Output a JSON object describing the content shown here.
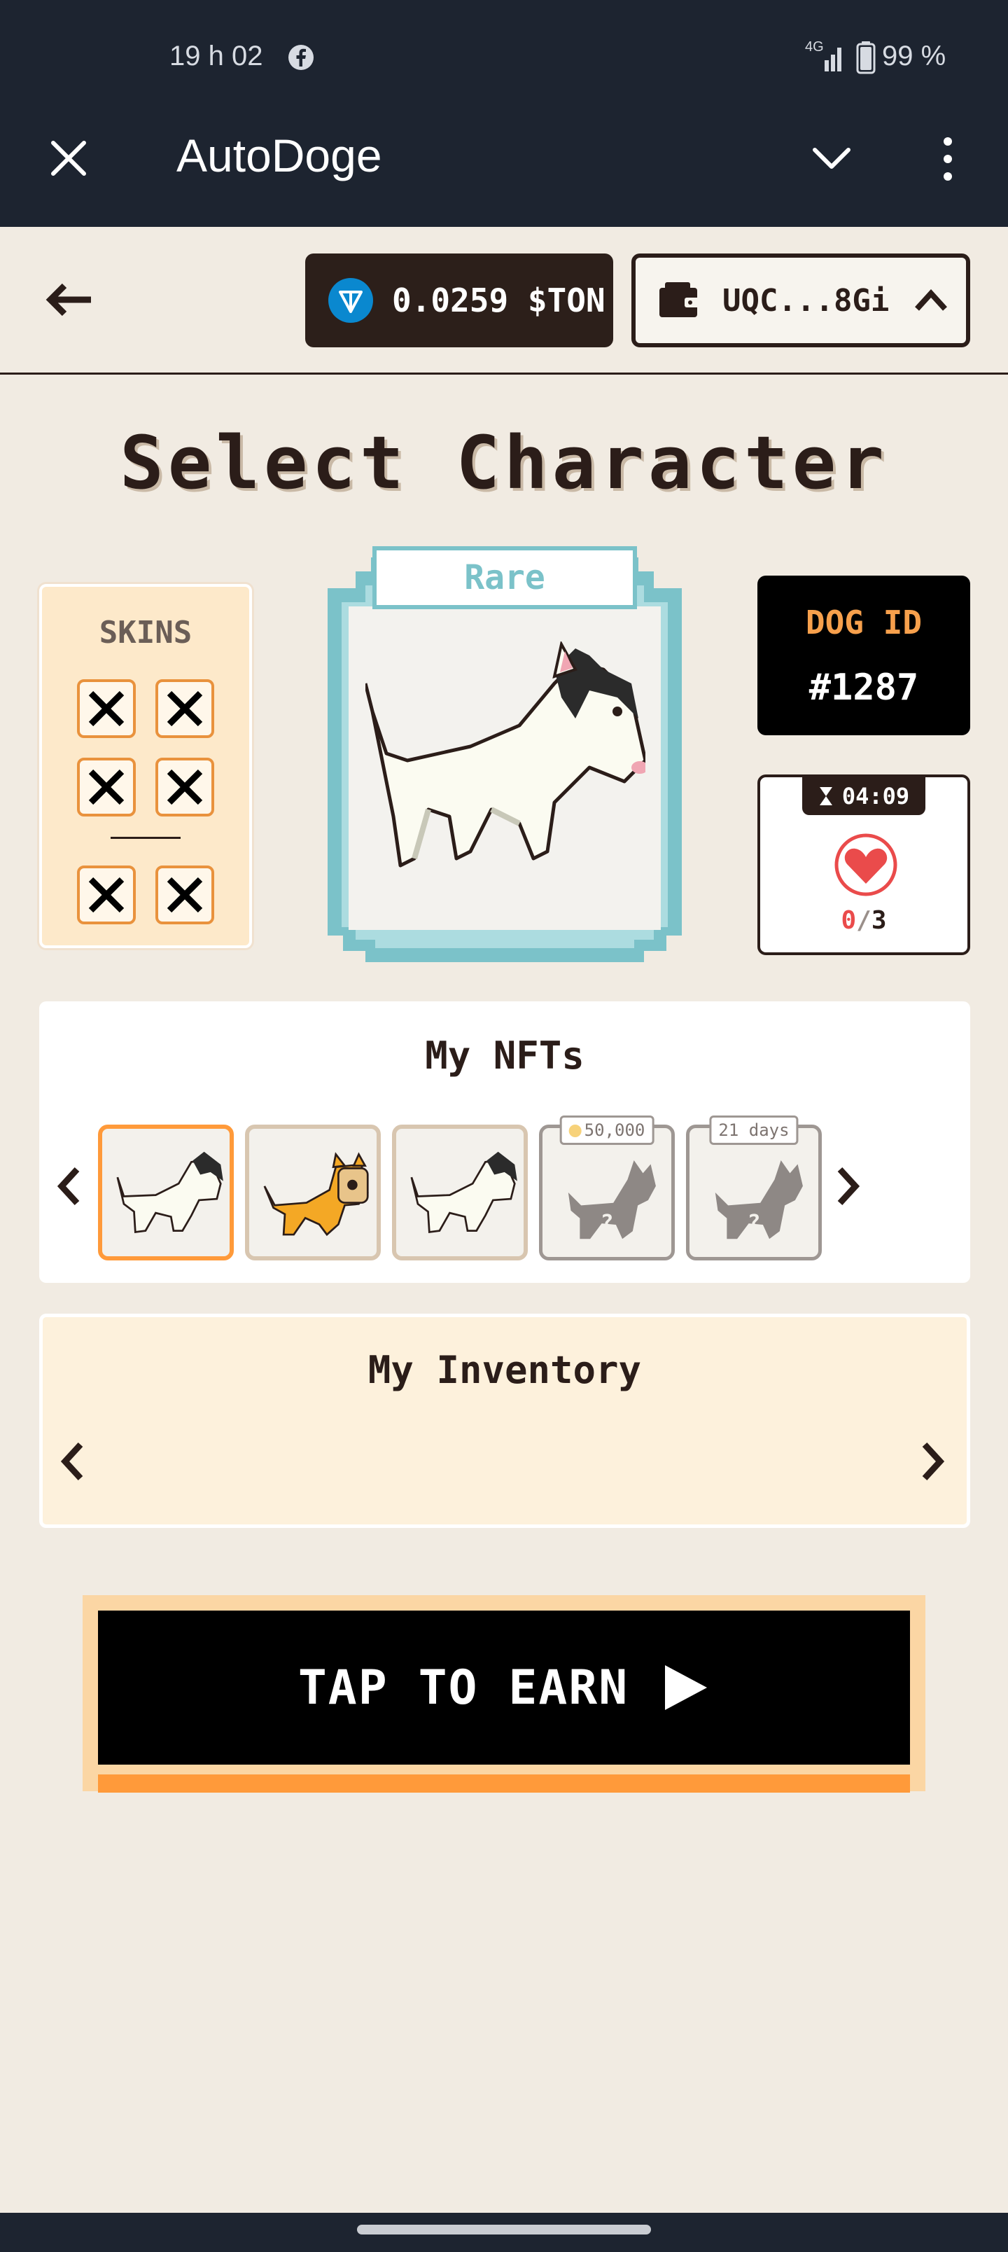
{
  "status_bar": {
    "time": "19 h 02",
    "network": "4G",
    "battery": "99 %"
  },
  "app_bar": {
    "title": "AutoDoge"
  },
  "header": {
    "ton_balance": "0.0259 $TON",
    "wallet_address": "UQC...8Gi"
  },
  "page": {
    "title": "Select Character"
  },
  "skins": {
    "label": "SKINS",
    "slot_count": 6
  },
  "character": {
    "rarity": "Rare"
  },
  "dog": {
    "id_label": "DOG ID",
    "id_value": "#1287"
  },
  "energy": {
    "timer": "04:09",
    "current": "0",
    "separator": "/",
    "max": "3"
  },
  "nfts": {
    "title": "My NFTs",
    "items": [
      {
        "kind": "bull-terrier",
        "selected": true
      },
      {
        "kind": "shiba-toast",
        "selected": false
      },
      {
        "kind": "bull-terrier",
        "selected": false
      },
      {
        "kind": "locked",
        "badge": "50,000"
      },
      {
        "kind": "locked",
        "badge": "21 days"
      }
    ]
  },
  "inventory": {
    "title": "My Inventory"
  },
  "cta": {
    "label": "TAP TO EARN"
  },
  "colors": {
    "app_bar": "#1d2430",
    "background": "#f1ebe2",
    "accent_orange": "#e9923d",
    "rare_teal": "#7bc2c9",
    "dog_id_text": "#f7a04c",
    "heart_red": "#ea4b4b"
  }
}
